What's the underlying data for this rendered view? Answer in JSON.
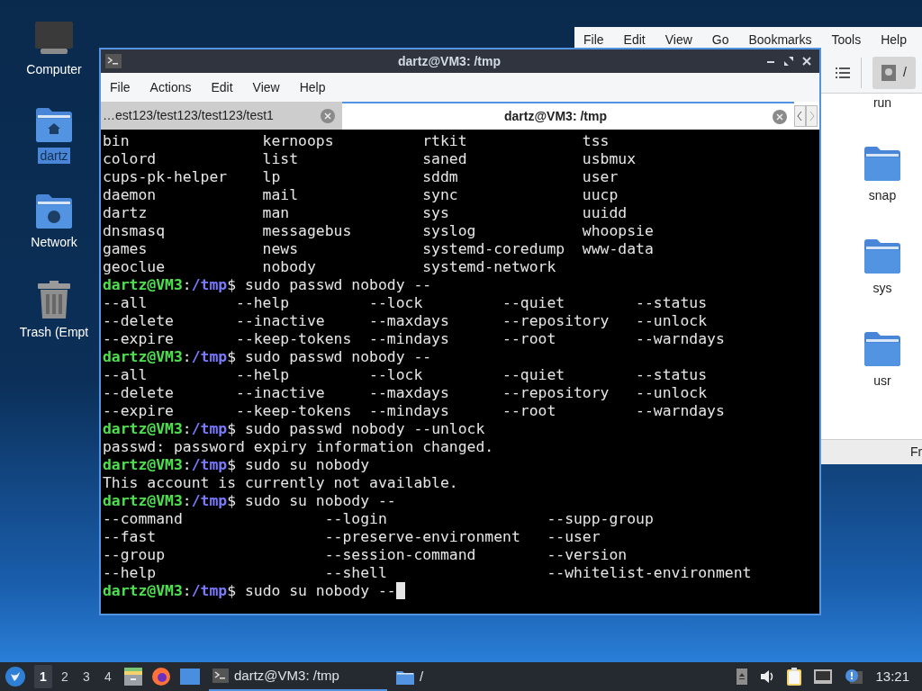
{
  "desktop_icons": [
    {
      "label": "Computer",
      "kind": "computer",
      "selected": false
    },
    {
      "label": "dartz",
      "kind": "home",
      "selected": true
    },
    {
      "label": "Network",
      "kind": "network",
      "selected": false
    },
    {
      "label": "Trash (Empt",
      "kind": "trash",
      "selected": false
    }
  ],
  "file_manager": {
    "menu": [
      "File",
      "Edit",
      "View",
      "Go",
      "Bookmarks",
      "Tools",
      "Help"
    ],
    "path_button": "/",
    "items": [
      "run",
      "snap",
      "sys",
      "usr"
    ],
    "status_text": "Fr"
  },
  "terminal": {
    "title": "dartz@VM3: /tmp",
    "menu": [
      "File",
      "Actions",
      "Edit",
      "View",
      "Help"
    ],
    "tabs": [
      {
        "label": "…est123/test123/test123/test1",
        "selected": false
      },
      {
        "label": "dartz@VM3: /tmp",
        "selected": true
      }
    ],
    "lines": [
      {
        "kind": "output",
        "text": "bin               kernoops          rtkit             tss"
      },
      {
        "kind": "output",
        "text": "colord            list              saned             usbmux"
      },
      {
        "kind": "output",
        "text": "cups-pk-helper    lp                sddm              user"
      },
      {
        "kind": "output",
        "text": "daemon            mail              sync              uucp"
      },
      {
        "kind": "output",
        "text": "dartz             man               sys               uuidd"
      },
      {
        "kind": "output",
        "text": "dnsmasq           messagebus        syslog            whoopsie"
      },
      {
        "kind": "output",
        "text": "games             news              systemd-coredump  www-data"
      },
      {
        "kind": "output",
        "text": "geoclue           nobody            systemd-network"
      },
      {
        "kind": "prompt",
        "user": "dartz@VM3",
        "colon": ":",
        "path": "/tmp",
        "command": "$ sudo passwd nobody --",
        "cursor": false
      },
      {
        "kind": "output",
        "text": "--all          --help         --lock         --quiet        --status"
      },
      {
        "kind": "output",
        "text": "--delete       --inactive     --maxdays      --repository   --unlock"
      },
      {
        "kind": "output",
        "text": "--expire       --keep-tokens  --mindays      --root         --warndays"
      },
      {
        "kind": "prompt",
        "user": "dartz@VM3",
        "colon": ":",
        "path": "/tmp",
        "command": "$ sudo passwd nobody --",
        "cursor": false
      },
      {
        "kind": "output",
        "text": "--all          --help         --lock         --quiet        --status"
      },
      {
        "kind": "output",
        "text": "--delete       --inactive     --maxdays      --repository   --unlock"
      },
      {
        "kind": "output",
        "text": "--expire       --keep-tokens  --mindays      --root         --warndays"
      },
      {
        "kind": "prompt",
        "user": "dartz@VM3",
        "colon": ":",
        "path": "/tmp",
        "command": "$ sudo passwd nobody --unlock",
        "cursor": false
      },
      {
        "kind": "output",
        "text": "passwd: password expiry information changed."
      },
      {
        "kind": "prompt",
        "user": "dartz@VM3",
        "colon": ":",
        "path": "/tmp",
        "command": "$ sudo su nobody",
        "cursor": false
      },
      {
        "kind": "output",
        "text": "This account is currently not available."
      },
      {
        "kind": "prompt",
        "user": "dartz@VM3",
        "colon": ":",
        "path": "/tmp",
        "command": "$ sudo su nobody --",
        "cursor": false
      },
      {
        "kind": "output",
        "text": "--command                --login                  --supp-group"
      },
      {
        "kind": "output",
        "text": "--fast                   --preserve-environment   --user"
      },
      {
        "kind": "output",
        "text": "--group                  --session-command        --version"
      },
      {
        "kind": "output",
        "text": "--help                   --shell                  --whitelist-environment"
      },
      {
        "kind": "prompt",
        "user": "dartz@VM3",
        "colon": ":",
        "path": "/tmp",
        "command": "$ sudo su nobody --",
        "cursor": true
      }
    ]
  },
  "taskbar": {
    "workspaces": [
      {
        "label": "1",
        "selected": true
      },
      {
        "label": "2",
        "selected": false
      },
      {
        "label": "3",
        "selected": false
      },
      {
        "label": "4",
        "selected": false
      }
    ],
    "tasks": [
      {
        "label": "dartz@VM3: /tmp",
        "kind": "terminal",
        "selected": true
      },
      {
        "label": "/",
        "kind": "folder",
        "selected": false
      }
    ],
    "clock": "13:21"
  }
}
